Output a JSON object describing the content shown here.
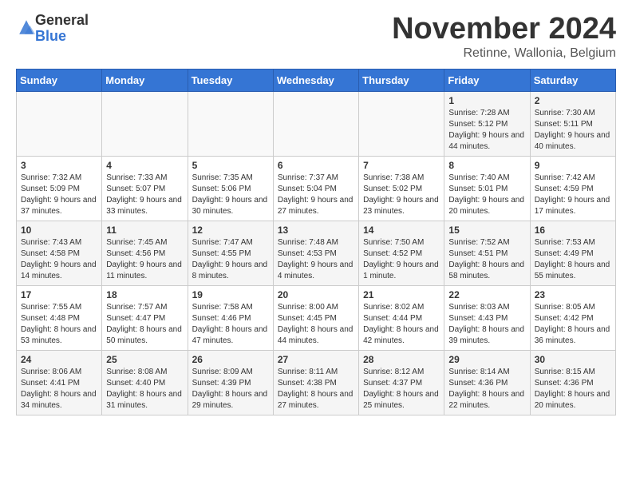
{
  "header": {
    "logo_general": "General",
    "logo_blue": "Blue",
    "month_title": "November 2024",
    "location": "Retinne, Wallonia, Belgium"
  },
  "weekdays": [
    "Sunday",
    "Monday",
    "Tuesday",
    "Wednesday",
    "Thursday",
    "Friday",
    "Saturday"
  ],
  "weeks": [
    [
      {
        "day": "",
        "info": ""
      },
      {
        "day": "",
        "info": ""
      },
      {
        "day": "",
        "info": ""
      },
      {
        "day": "",
        "info": ""
      },
      {
        "day": "",
        "info": ""
      },
      {
        "day": "1",
        "info": "Sunrise: 7:28 AM\nSunset: 5:12 PM\nDaylight: 9 hours and 44 minutes."
      },
      {
        "day": "2",
        "info": "Sunrise: 7:30 AM\nSunset: 5:11 PM\nDaylight: 9 hours and 40 minutes."
      }
    ],
    [
      {
        "day": "3",
        "info": "Sunrise: 7:32 AM\nSunset: 5:09 PM\nDaylight: 9 hours and 37 minutes."
      },
      {
        "day": "4",
        "info": "Sunrise: 7:33 AM\nSunset: 5:07 PM\nDaylight: 9 hours and 33 minutes."
      },
      {
        "day": "5",
        "info": "Sunrise: 7:35 AM\nSunset: 5:06 PM\nDaylight: 9 hours and 30 minutes."
      },
      {
        "day": "6",
        "info": "Sunrise: 7:37 AM\nSunset: 5:04 PM\nDaylight: 9 hours and 27 minutes."
      },
      {
        "day": "7",
        "info": "Sunrise: 7:38 AM\nSunset: 5:02 PM\nDaylight: 9 hours and 23 minutes."
      },
      {
        "day": "8",
        "info": "Sunrise: 7:40 AM\nSunset: 5:01 PM\nDaylight: 9 hours and 20 minutes."
      },
      {
        "day": "9",
        "info": "Sunrise: 7:42 AM\nSunset: 4:59 PM\nDaylight: 9 hours and 17 minutes."
      }
    ],
    [
      {
        "day": "10",
        "info": "Sunrise: 7:43 AM\nSunset: 4:58 PM\nDaylight: 9 hours and 14 minutes."
      },
      {
        "day": "11",
        "info": "Sunrise: 7:45 AM\nSunset: 4:56 PM\nDaylight: 9 hours and 11 minutes."
      },
      {
        "day": "12",
        "info": "Sunrise: 7:47 AM\nSunset: 4:55 PM\nDaylight: 9 hours and 8 minutes."
      },
      {
        "day": "13",
        "info": "Sunrise: 7:48 AM\nSunset: 4:53 PM\nDaylight: 9 hours and 4 minutes."
      },
      {
        "day": "14",
        "info": "Sunrise: 7:50 AM\nSunset: 4:52 PM\nDaylight: 9 hours and 1 minute."
      },
      {
        "day": "15",
        "info": "Sunrise: 7:52 AM\nSunset: 4:51 PM\nDaylight: 8 hours and 58 minutes."
      },
      {
        "day": "16",
        "info": "Sunrise: 7:53 AM\nSunset: 4:49 PM\nDaylight: 8 hours and 55 minutes."
      }
    ],
    [
      {
        "day": "17",
        "info": "Sunrise: 7:55 AM\nSunset: 4:48 PM\nDaylight: 8 hours and 53 minutes."
      },
      {
        "day": "18",
        "info": "Sunrise: 7:57 AM\nSunset: 4:47 PM\nDaylight: 8 hours and 50 minutes."
      },
      {
        "day": "19",
        "info": "Sunrise: 7:58 AM\nSunset: 4:46 PM\nDaylight: 8 hours and 47 minutes."
      },
      {
        "day": "20",
        "info": "Sunrise: 8:00 AM\nSunset: 4:45 PM\nDaylight: 8 hours and 44 minutes."
      },
      {
        "day": "21",
        "info": "Sunrise: 8:02 AM\nSunset: 4:44 PM\nDaylight: 8 hours and 42 minutes."
      },
      {
        "day": "22",
        "info": "Sunrise: 8:03 AM\nSunset: 4:43 PM\nDaylight: 8 hours and 39 minutes."
      },
      {
        "day": "23",
        "info": "Sunrise: 8:05 AM\nSunset: 4:42 PM\nDaylight: 8 hours and 36 minutes."
      }
    ],
    [
      {
        "day": "24",
        "info": "Sunrise: 8:06 AM\nSunset: 4:41 PM\nDaylight: 8 hours and 34 minutes."
      },
      {
        "day": "25",
        "info": "Sunrise: 8:08 AM\nSunset: 4:40 PM\nDaylight: 8 hours and 31 minutes."
      },
      {
        "day": "26",
        "info": "Sunrise: 8:09 AM\nSunset: 4:39 PM\nDaylight: 8 hours and 29 minutes."
      },
      {
        "day": "27",
        "info": "Sunrise: 8:11 AM\nSunset: 4:38 PM\nDaylight: 8 hours and 27 minutes."
      },
      {
        "day": "28",
        "info": "Sunrise: 8:12 AM\nSunset: 4:37 PM\nDaylight: 8 hours and 25 minutes."
      },
      {
        "day": "29",
        "info": "Sunrise: 8:14 AM\nSunset: 4:36 PM\nDaylight: 8 hours and 22 minutes."
      },
      {
        "day": "30",
        "info": "Sunrise: 8:15 AM\nSunset: 4:36 PM\nDaylight: 8 hours and 20 minutes."
      }
    ]
  ]
}
